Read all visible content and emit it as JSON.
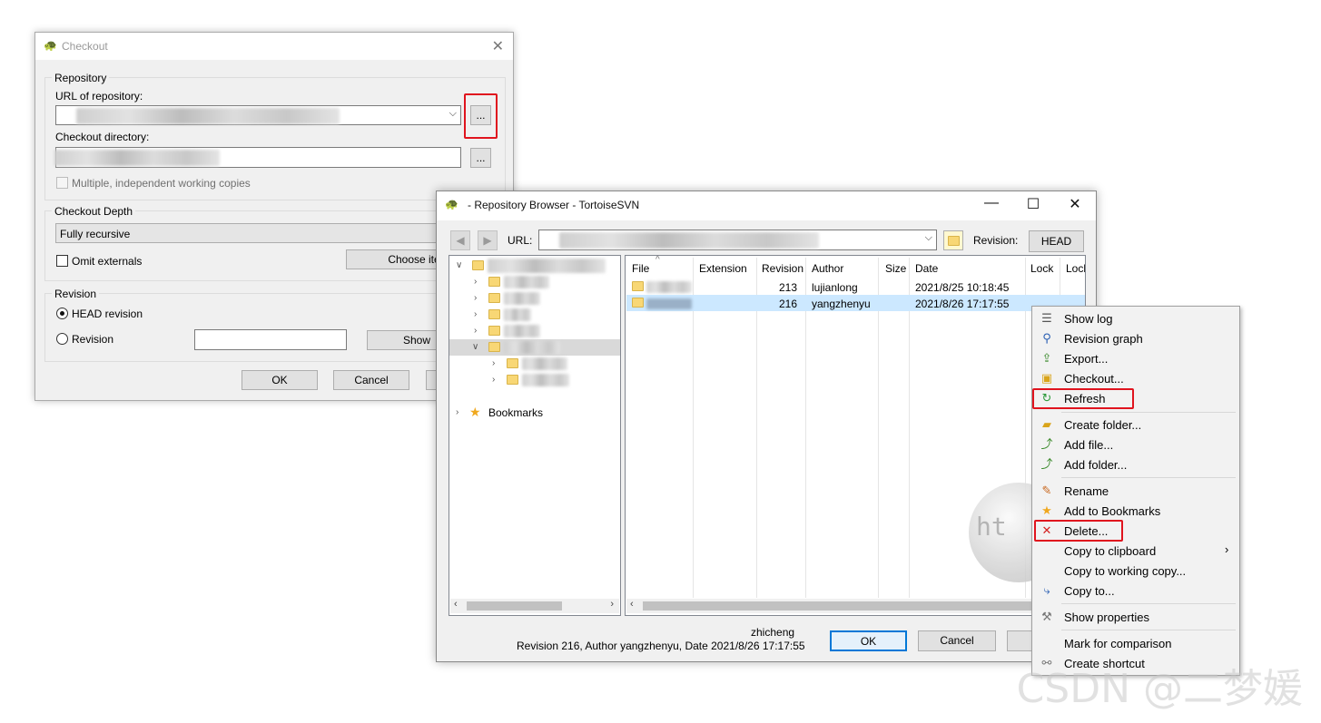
{
  "checkout": {
    "title": "Checkout",
    "repository_group": "Repository",
    "url_label": "URL of repository:",
    "browse_label": "...",
    "dir_label": "Checkout directory:",
    "dir_browse_label": "...",
    "multiple_copies_label": "Multiple, independent working copies",
    "depth_group": "Checkout Depth",
    "depth_value": "Fully recursive",
    "omit_externals_label": "Omit externals",
    "choose_items_label": "Choose item",
    "revision_group": "Revision",
    "head_revision_label": "HEAD revision",
    "revision_label": "Revision",
    "show_log_label": "Show",
    "ok_label": "OK",
    "cancel_label": "Cancel"
  },
  "repo_browser": {
    "title": "- Repository Browser - TortoiseSVN",
    "url_label": "URL:",
    "revision_label": "Revision:",
    "head_button": "HEAD",
    "tree": {
      "bookmarks_label": "Bookmarks"
    },
    "columns": [
      "File",
      "Extension",
      "Revision",
      "Author",
      "Size",
      "Date",
      "Lock",
      "Lock"
    ],
    "rows": [
      {
        "revision": "213",
        "author": "lujianlong",
        "date": "2021/8/25 10:18:45"
      },
      {
        "revision": "216",
        "author": "yangzhenyu",
        "date": "2021/8/26 17:17:55"
      }
    ],
    "status_user": "zhicheng",
    "status_line": "Revision 216, Author yangzhenyu, Date 2021/8/26 17:17:55",
    "ok_label": "OK",
    "cancel_label": "Cancel"
  },
  "context_menu": {
    "items": [
      {
        "label": "Show log",
        "icon": "show-log-icon"
      },
      {
        "label": "Revision graph",
        "icon": "revision-graph-icon"
      },
      {
        "label": "Export...",
        "icon": "export-icon"
      },
      {
        "label": "Checkout...",
        "icon": "checkout-icon"
      },
      {
        "label": "Refresh",
        "icon": "refresh-icon"
      },
      {
        "label": "Create folder...",
        "icon": "create-folder-icon"
      },
      {
        "label": "Add file...",
        "icon": "add-file-icon"
      },
      {
        "label": "Add folder...",
        "icon": "add-folder-icon"
      },
      {
        "label": "Rename",
        "icon": "rename-icon"
      },
      {
        "label": "Add to Bookmarks",
        "icon": "bookmark-star-icon"
      },
      {
        "label": "Delete...",
        "icon": "delete-icon"
      },
      {
        "label": "Copy to clipboard",
        "icon": ""
      },
      {
        "label": "Copy to working copy...",
        "icon": ""
      },
      {
        "label": "Copy to...",
        "icon": "copy-to-icon"
      },
      {
        "label": "Show properties",
        "icon": "properties-wrench-icon"
      },
      {
        "label": "Mark for comparison",
        "icon": ""
      },
      {
        "label": "Create shortcut",
        "icon": "shortcut-icon"
      }
    ]
  },
  "watermark": "CSDN @二梦媛",
  "colors": {
    "highlight_red": "#e0141e",
    "selection_blue": "#cce8ff",
    "folder_yellow": "#f8d775"
  }
}
